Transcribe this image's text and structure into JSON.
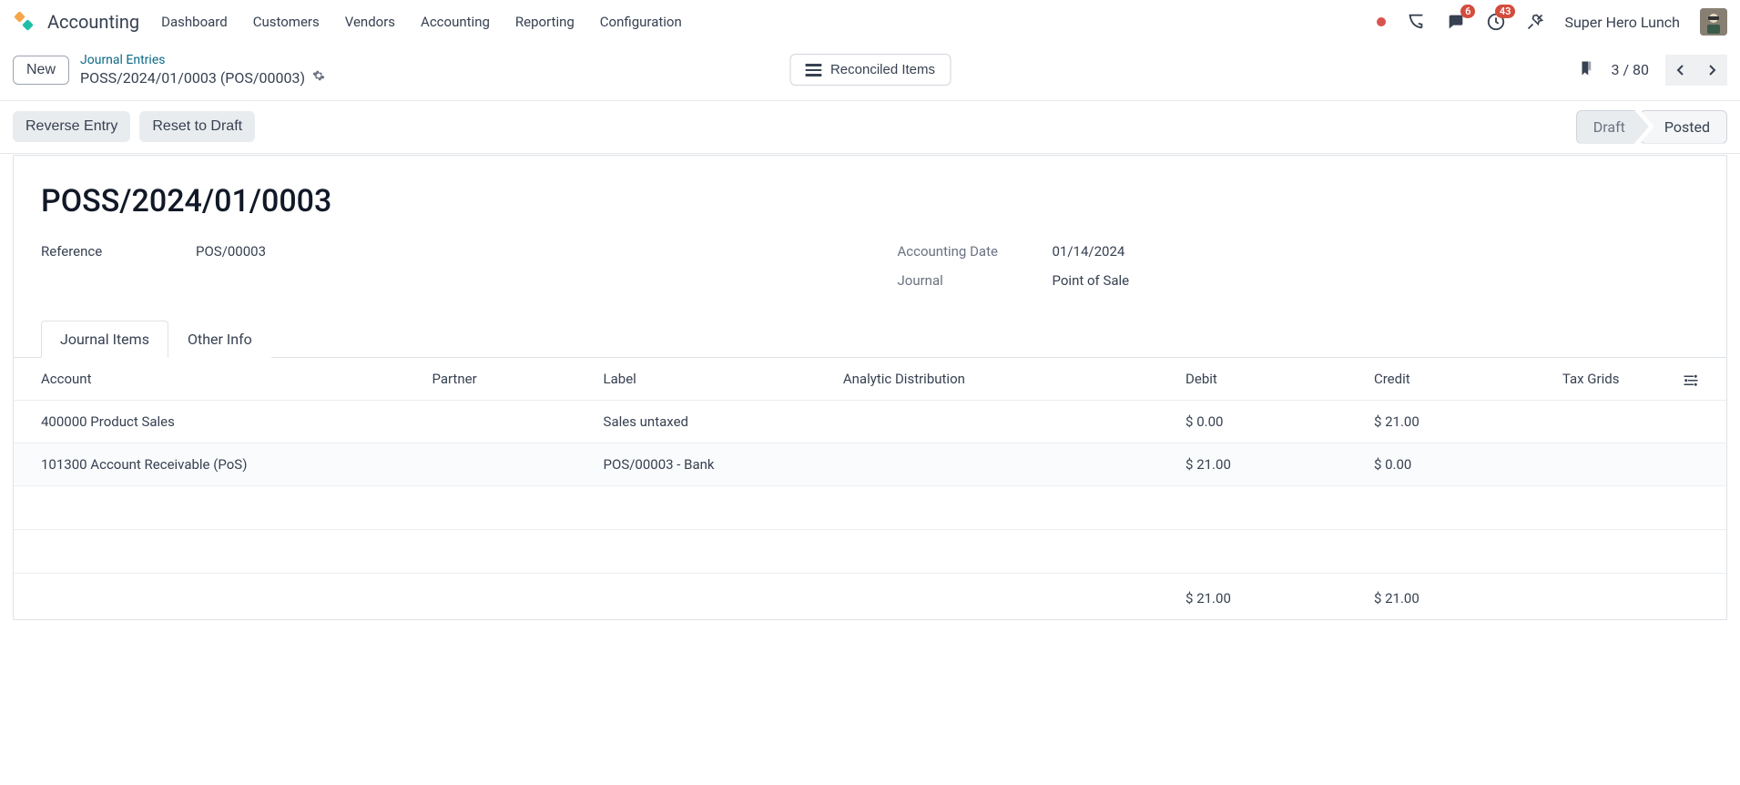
{
  "nav": {
    "app_title": "Accounting",
    "links": [
      "Dashboard",
      "Customers",
      "Vendors",
      "Accounting",
      "Reporting",
      "Configuration"
    ],
    "messages_badge": "6",
    "activities_badge": "43",
    "company": "Super Hero Lunch"
  },
  "control": {
    "new_label": "New",
    "breadcrumb_parent": "Journal Entries",
    "breadcrumb_current": "POSS/2024/01/0003 (POS/00003)",
    "reconciled_label": "Reconciled Items",
    "pager": "3 / 80"
  },
  "actions": {
    "reverse": "Reverse Entry",
    "reset": "Reset to Draft"
  },
  "status": {
    "draft": "Draft",
    "posted": "Posted"
  },
  "record": {
    "title": "POSS/2024/01/0003",
    "reference_label": "Reference",
    "reference_value": "POS/00003",
    "date_label": "Accounting Date",
    "date_value": "01/14/2024",
    "journal_label": "Journal",
    "journal_value": "Point of Sale"
  },
  "tabs": {
    "journal_items": "Journal Items",
    "other_info": "Other Info"
  },
  "table": {
    "headers": {
      "account": "Account",
      "partner": "Partner",
      "label": "Label",
      "analytic": "Analytic Distribution",
      "debit": "Debit",
      "credit": "Credit",
      "tax_grids": "Tax Grids"
    },
    "rows": [
      {
        "account": "400000 Product Sales",
        "partner": "",
        "label": "Sales untaxed",
        "analytic": "",
        "debit": "$ 0.00",
        "credit": "$ 21.00",
        "tax_grids": ""
      },
      {
        "account": "101300 Account Receivable (PoS)",
        "partner": "",
        "label": "POS/00003 - Bank",
        "analytic": "",
        "debit": "$ 21.00",
        "credit": "$ 0.00",
        "tax_grids": ""
      }
    ],
    "totals": {
      "debit": "$ 21.00",
      "credit": "$ 21.00"
    }
  }
}
